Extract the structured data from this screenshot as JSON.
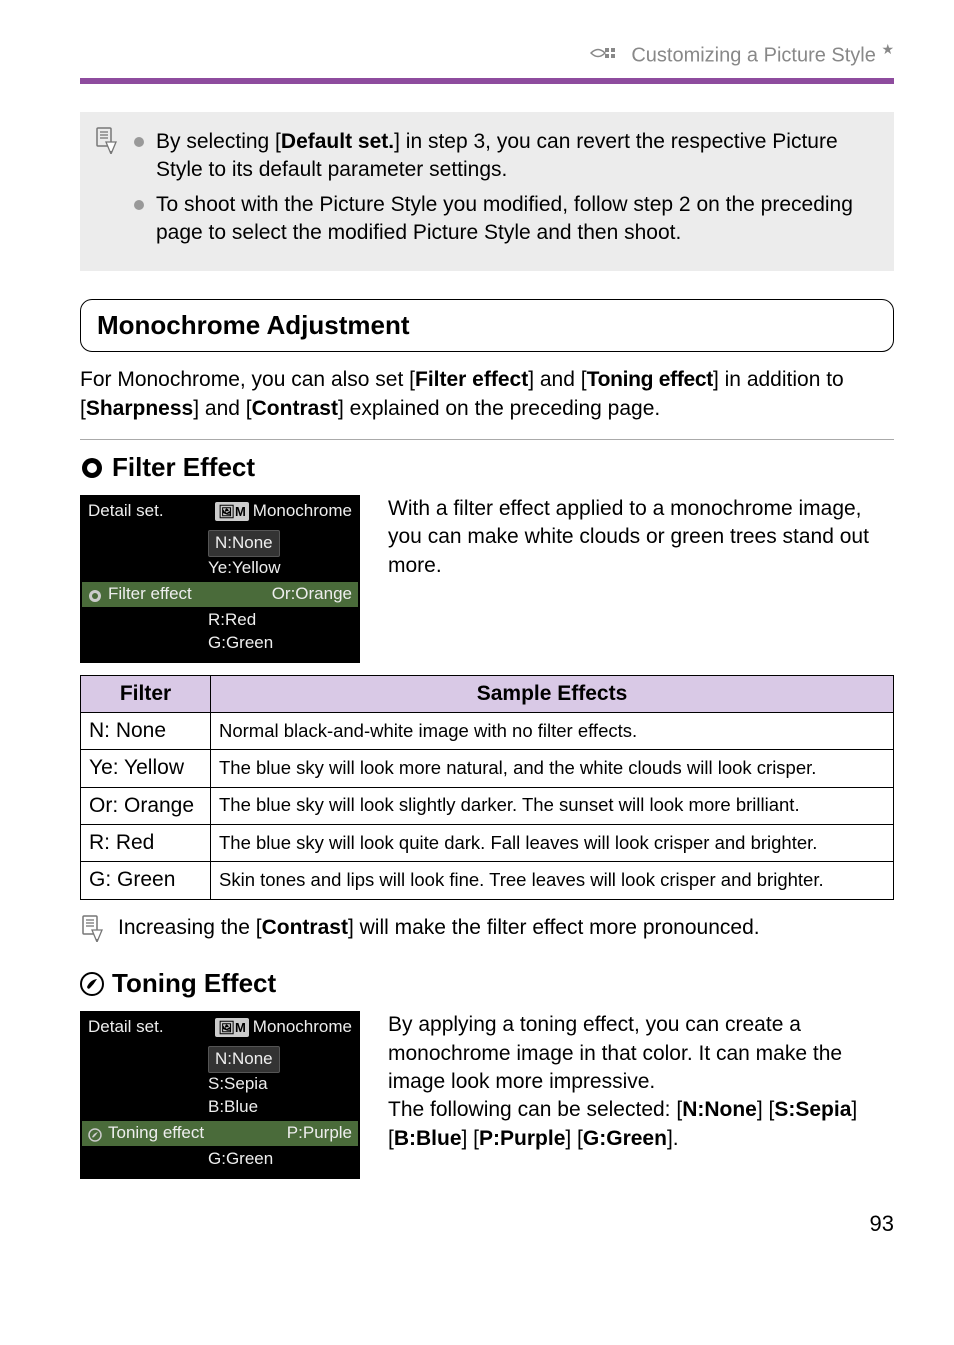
{
  "header": {
    "title_prefix": "Customizing a Picture Style",
    "star": "★"
  },
  "info_box": {
    "b1_pre": "By selecting [",
    "b1_bold": "Default set.",
    "b1_post": "] in step 3, you can revert the respective Picture Style to its default parameter settings.",
    "b2": "To shoot with the Picture Style you modified, follow step 2 on the preceding page to select the modified Picture Style and then shoot."
  },
  "mono": {
    "title": "Monochrome Adjustment",
    "intro_1": "For Monochrome, you can also set [",
    "intro_b1": "Filter effect",
    "intro_2": "] and [",
    "intro_b2": "Toning effect",
    "intro_3": "] in addition to [",
    "intro_b3": "Sharpness",
    "intro_4": "] and [",
    "intro_b4": "Contrast",
    "intro_5": "] explained on the preceding page."
  },
  "filter": {
    "heading": "Filter Effect",
    "lcd_title": "Detail set.",
    "lcd_mono_tag": "M",
    "lcd_mono_text": "Monochrome",
    "lcd_opts": [
      "N:None",
      "Ye:Yellow",
      "Or:Orange",
      "R:Red",
      "G:Green"
    ],
    "lcd_selected_label": "Filter effect",
    "desc": "With a filter effect applied to a monochrome image, you can make white clouds or green trees stand out more.",
    "table": {
      "h1": "Filter",
      "h2": "Sample Effects",
      "rows": [
        {
          "f": "N: None",
          "e": "Normal black-and-white image with no filter effects."
        },
        {
          "f": "Ye: Yellow",
          "e": "The blue sky will look more natural, and the white clouds will look crisper."
        },
        {
          "f": "Or: Orange",
          "e": "The blue sky will look slightly darker. The sunset will look more brilliant."
        },
        {
          "f": "R: Red",
          "e": "The blue sky will look quite dark. Fall leaves will look crisper and brighter."
        },
        {
          "f": "G: Green",
          "e": "Skin tones and lips will look fine. Tree leaves will look crisper and brighter."
        }
      ]
    },
    "note_pre": "Increasing the [",
    "note_bold": "Contrast",
    "note_post": "] will make the filter effect more pronounced."
  },
  "toning": {
    "heading": "Toning Effect",
    "lcd_title": "Detail set.",
    "lcd_mono_tag": "M",
    "lcd_mono_text": "Monochrome",
    "lcd_opts": [
      "N:None",
      "S:Sepia",
      "B:Blue",
      "P:Purple",
      "G:Green"
    ],
    "lcd_selected_label": "Toning effect",
    "desc_1": "By applying a toning effect, you can create a monochrome image in that color. It can make the image look more impressive.",
    "desc_2a": "The following can be selected: [",
    "desc_2_nnone": "N:None",
    "desc_2b": "] [",
    "desc_2_sepia": "S:Sepia",
    "desc_2c": "] [",
    "desc_2_blue": "B:Blue",
    "desc_2d": "] [",
    "desc_2_purple": "P:Purple",
    "desc_2e": "] [",
    "desc_2_green": "G:Green",
    "desc_2f": "]."
  },
  "page_number": "93"
}
